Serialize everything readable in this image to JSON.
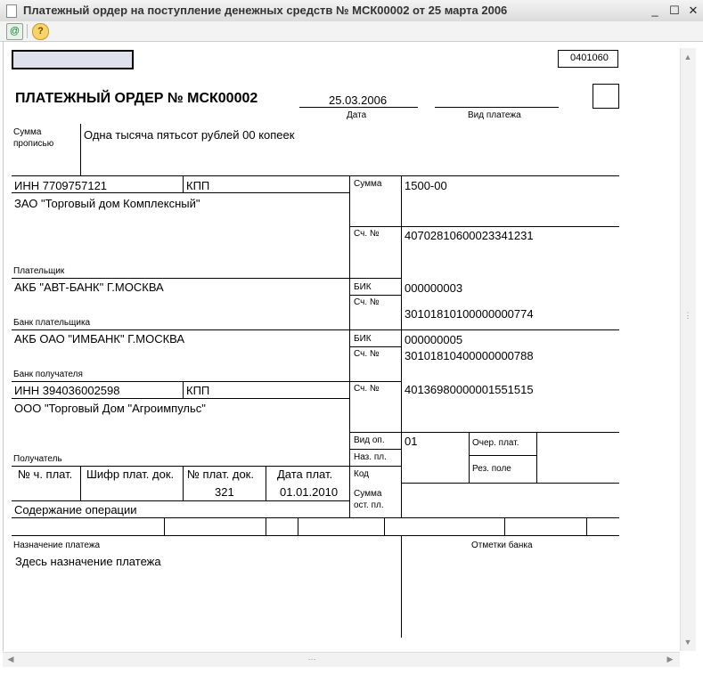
{
  "window": {
    "title": "Платежный ордер на поступление денежных средств № МСК00002 от 25 марта 2006",
    "minimize": "_",
    "maximize": "☐",
    "close": "✕"
  },
  "toolbar": {
    "help": "?"
  },
  "form": {
    "okud_code": "0401060",
    "heading": "ПЛАТЕЖНЫЙ ОРДЕР № МСК00002",
    "date_value": "25.03.2006",
    "date_label": "Дата",
    "payment_type_label": "Вид платежа",
    "amount_words_label": "Сумма\nпрописью",
    "amount_words": "Одна тысяча пятьсот рублей 00 копеек",
    "payer_inn": "ИНН 7709757121",
    "kpp_label": "КПП",
    "payer_name": "ЗАО \"Торговый дом Комплексный\"",
    "payer_label": "Плательщик",
    "sum_label": "Сумма",
    "sum_value": "1500-00",
    "account_label": "Сч. №",
    "payer_account": "40702810600023341231",
    "payer_bank": "АКБ \"АВТ-БАНК\" Г.МОСКВА",
    "payer_bank_label": "Банк плательщика",
    "bik_label": "БИК",
    "payer_bik": "000000003",
    "payer_corr_account": "30101810100000000774",
    "recipient_bank": "АКБ ОАО \"ИМБАНК\" Г.МОСКВА",
    "recipient_bank_label": "Банк получателя",
    "recipient_bik": "000000005",
    "recipient_corr_account": "30101810400000000788",
    "recipient_inn": "ИНН 394036002598",
    "recipient_account": "40136980000001551515",
    "recipient_name": "ООО \"Торговый Дом \"Агроимпульс\"",
    "recipient_label": "Получатель",
    "op_type_label": "Вид оп.",
    "op_type_value": "01",
    "pay_purpose_label": "Наз. пл.",
    "code_label": "Код",
    "priority_label": "Очер. плат.",
    "reserve_label": "Рез. поле",
    "part_no_label": "№ ч. плат.",
    "doc_cipher_label": "Шифр плат. док.",
    "doc_no_label": "№ плат. док.",
    "doc_no_value": "321",
    "doc_date_label": "Дата плат.",
    "doc_date_value": "01.01.2010",
    "balance_label": "Сумма\nост. пл.",
    "operation_content_label": "Содержание операции",
    "purpose_label": "Назначение платежа",
    "purpose_value": "Здесь назначение платежа",
    "bank_marks_label": "Отметки банка"
  }
}
